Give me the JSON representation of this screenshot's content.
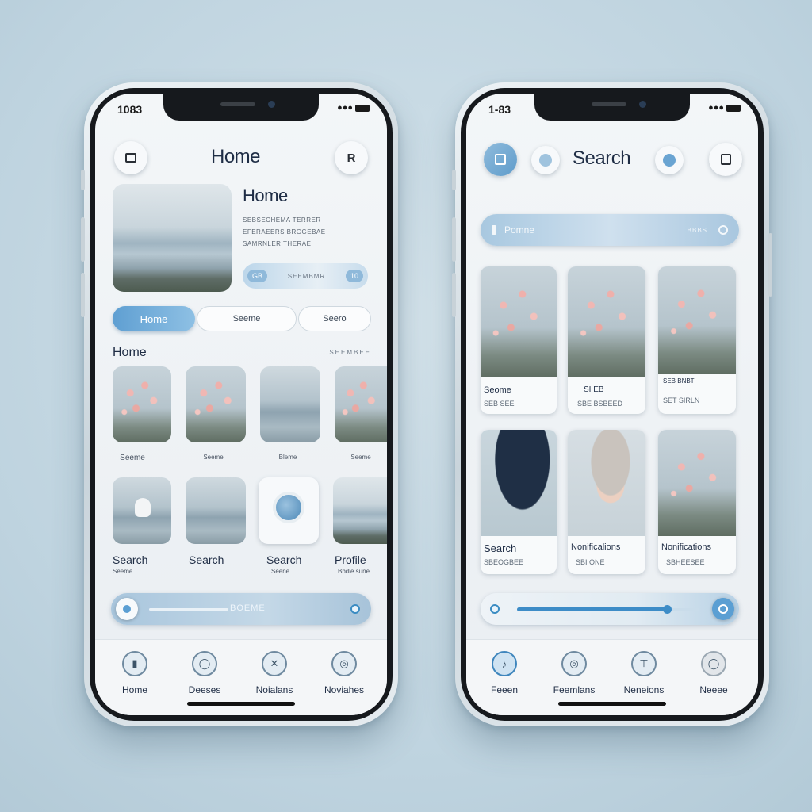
{
  "left_phone": {
    "status_time": "1083",
    "header": {
      "title": "Home",
      "left_icon": "square-icon",
      "right_button_label": "R"
    },
    "hero": {
      "title": "Home",
      "desc_lines": [
        "SEBSECHEMA TERRER",
        "EFERAEERS BRGGEBAE",
        "SAMRNLER THERAE"
      ],
      "pill_left": "GB",
      "pill_text": "SEEMBMR",
      "pill_right": "10"
    },
    "tabs": [
      "Home",
      "Seeme",
      "Seero"
    ],
    "section": {
      "title": "Home",
      "action": "SEEMBEE"
    },
    "grid_row1_captions": [
      "Seeme",
      "Seeme",
      "Bleme",
      "Seeme"
    ],
    "grid_row2": [
      {
        "label": "Search",
        "sub": "Seeme"
      },
      {
        "label": "Search",
        "sub": ""
      },
      {
        "label": "Search",
        "sub": "Seene"
      },
      {
        "label": "Profile",
        "sub": "Bbdle sune"
      }
    ],
    "slider": {
      "label": "BOEME",
      "value_pct": 0.12
    },
    "tabbar": [
      "Home",
      "Deeses",
      "Noialans",
      "Noviahes"
    ]
  },
  "right_phone": {
    "status_time": "1-83",
    "header": {
      "title": "Search",
      "left_icon": "layout-icon",
      "right_icon": "copy-icon"
    },
    "search": {
      "placeholder": "Pomne",
      "right_text": "BBBS",
      "left_icon": "lock-icon"
    },
    "grid_row1": [
      {
        "label": "Seome",
        "sub": "SEB SEE"
      },
      {
        "label": "SI EB",
        "sub": "SBE BSBEED"
      },
      {
        "label": "SEB BNBT",
        "sub": "SET SIRLN"
      }
    ],
    "grid_row2": [
      {
        "label": "Search",
        "sub": "SBEOGBEE"
      },
      {
        "label": "Nonificalions",
        "sub": "SBI ONE"
      },
      {
        "label": "Nonifications",
        "sub": "SBHEESEE"
      }
    ],
    "slider": {
      "value_pct": 0.82
    },
    "tabbar": [
      "Feeen",
      "Feemlans",
      "Neneions",
      "Neeee"
    ]
  },
  "colors": {
    "accent": "#5b9fd3",
    "accent_light": "#cfe1ef",
    "text": "#1f2d45"
  }
}
